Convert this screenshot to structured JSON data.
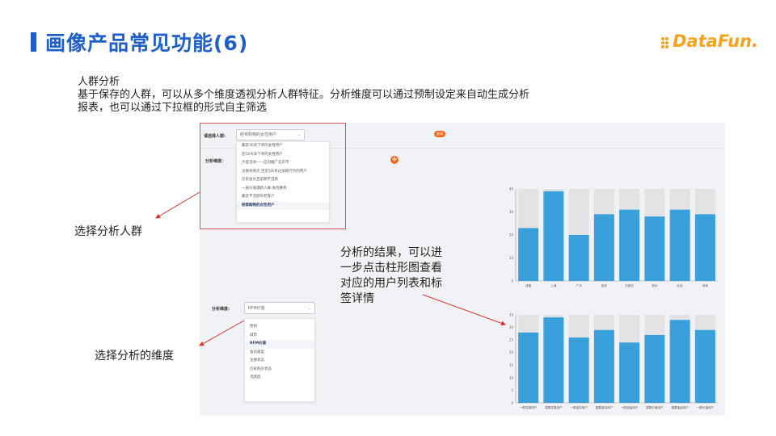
{
  "slide": {
    "title": "画像产品常见功能(6)",
    "logo_text": "DataFun."
  },
  "description": {
    "heading": "人群分析",
    "line1": "基于保存的人群，可以从多个维度透视分析人群特征。分析维度可以通过预制设定来自动生成分析",
    "line2": "报表，也可以通过下拉框的形式自主筛选"
  },
  "callouts": {
    "select_crowd": "选择分析人群",
    "select_dimension": "选择分析的维度",
    "result_line1": "分析的结果，可以进",
    "result_line2": "一步点击柱形图查看",
    "result_line3": "对应的用户列表和标",
    "result_line4": "签详情"
  },
  "top_panel": {
    "crowd_label": "请选择人群:",
    "crowd_value": "经常购物的女性用户",
    "query_button": "查询",
    "dimension_label": "分析维度:",
    "crowd_options": [
      "最近30天下单的女性用户",
      "近10天未下单的女性用户",
      "大促活动——应向推广北京市",
      "注册未购买,且近5天有过加购行为的用户",
      "历史会员且近期不活跃",
      "一般价值潜新人群-发优惠券",
      "最近不活跃的老客户",
      "经常购物的女性用户"
    ],
    "active_option_index": 7
  },
  "bottom_panel": {
    "dimension_label": "分析维度:",
    "dimension_value": "RFM价值",
    "dimension_options": [
      "性别",
      "城市",
      "RFM价值",
      "会员类型",
      "注册状态",
      "历史购买状态",
      "活跃度"
    ],
    "active_option_index": 2
  },
  "colors": {
    "title_blue": "#1f5fc9",
    "logo_orange": "#f7a21b",
    "bar_blue": "#3aa0dc",
    "bar_bg": "#e3e3e5",
    "accent_orange": "#f26b1f",
    "arrow_red": "#d9342b"
  },
  "chart_data": [
    {
      "type": "bar",
      "categories": [
        "成都",
        "上海",
        "广州",
        "西安",
        "石家庄",
        "杭州",
        "北京",
        "深圳"
      ],
      "values": [
        23,
        39,
        20,
        29,
        31,
        28,
        31,
        29
      ],
      "ylim": [
        0,
        40
      ],
      "yticks": [
        0,
        10,
        20,
        30,
        40
      ],
      "grid": false
    },
    {
      "type": "bar",
      "categories": [
        "一般发展用户",
        "重要发展用户",
        "一般保持用户",
        "重要保持用户",
        "一般挽留用户",
        "重要价值用户",
        "重要挽留用户",
        "一般价值用户"
      ],
      "values": [
        28,
        34,
        26,
        29,
        24,
        27,
        33,
        29
      ],
      "ylim": [
        0,
        35
      ],
      "yticks": [
        0,
        5,
        10,
        15,
        20,
        25,
        30,
        35
      ],
      "grid": false
    }
  ]
}
